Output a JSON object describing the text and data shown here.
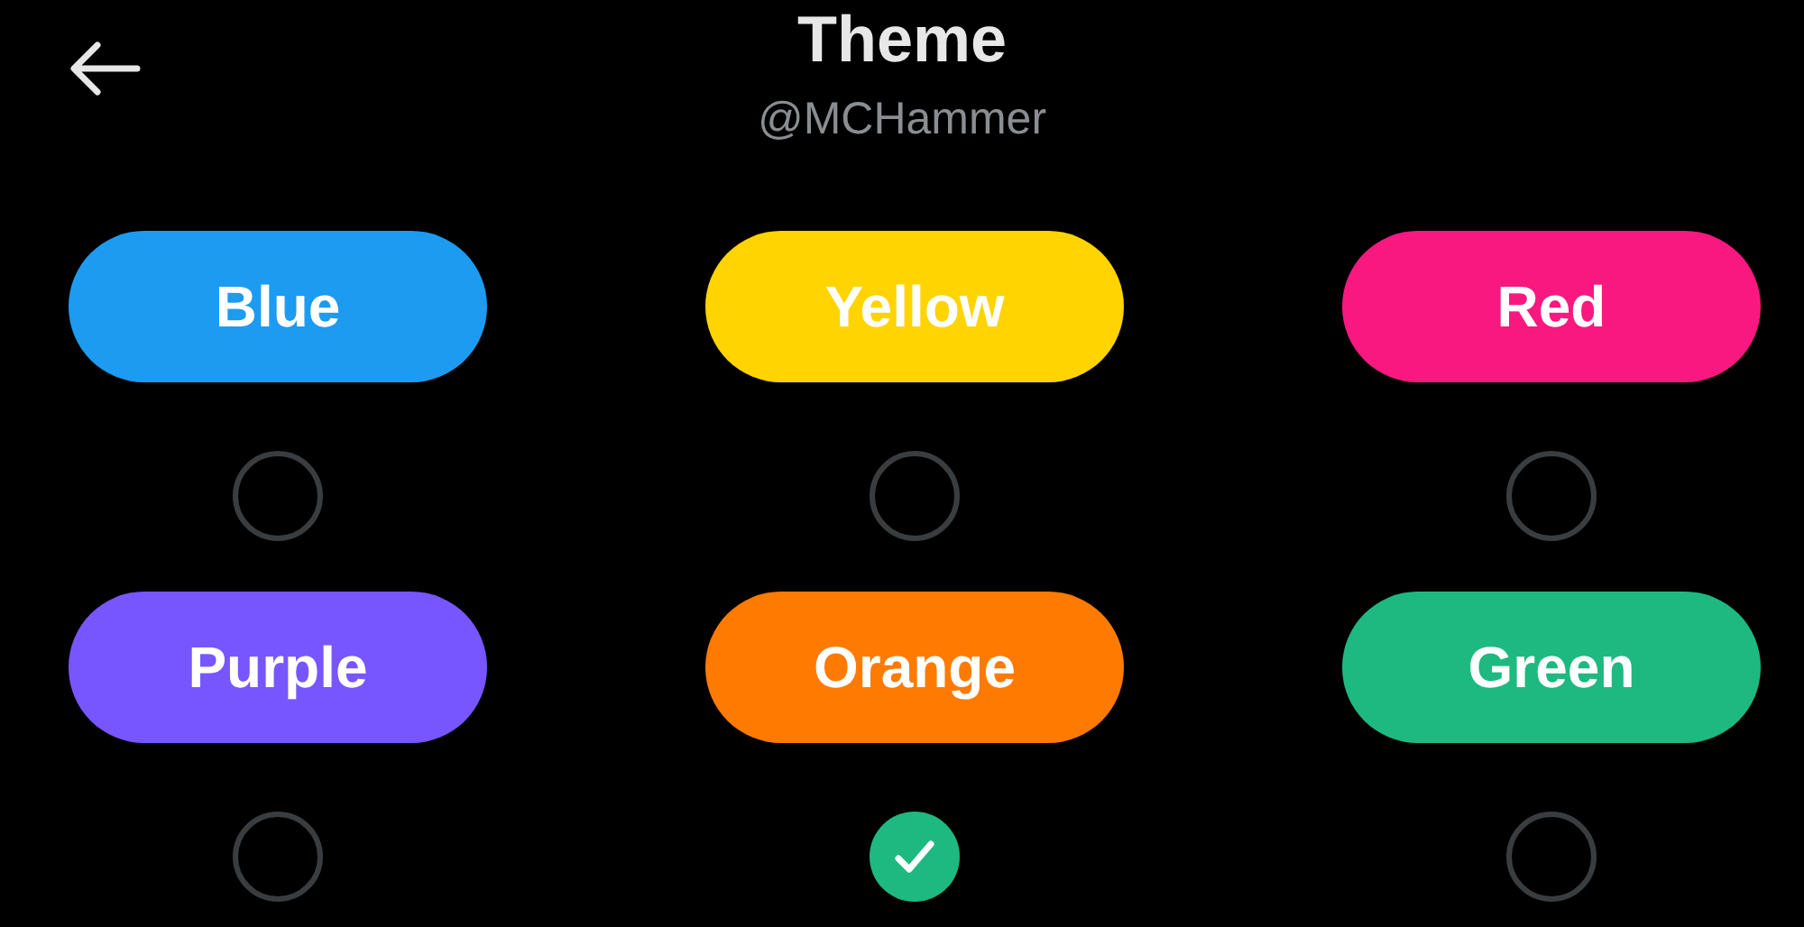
{
  "header": {
    "title": "Theme",
    "subtitle": "@MCHammer"
  },
  "themes": [
    {
      "label": "Blue",
      "color": "#1d9bf0",
      "selected": false
    },
    {
      "label": "Yellow",
      "color": "#ffd400",
      "selected": false
    },
    {
      "label": "Red",
      "color": "#f91880",
      "selected": false
    },
    {
      "label": "Purple",
      "color": "#7856ff",
      "selected": false
    },
    {
      "label": "Orange",
      "color": "#ff7a00",
      "selected": true
    },
    {
      "label": "Green",
      "color": "#1eb980",
      "selected": false
    }
  ]
}
